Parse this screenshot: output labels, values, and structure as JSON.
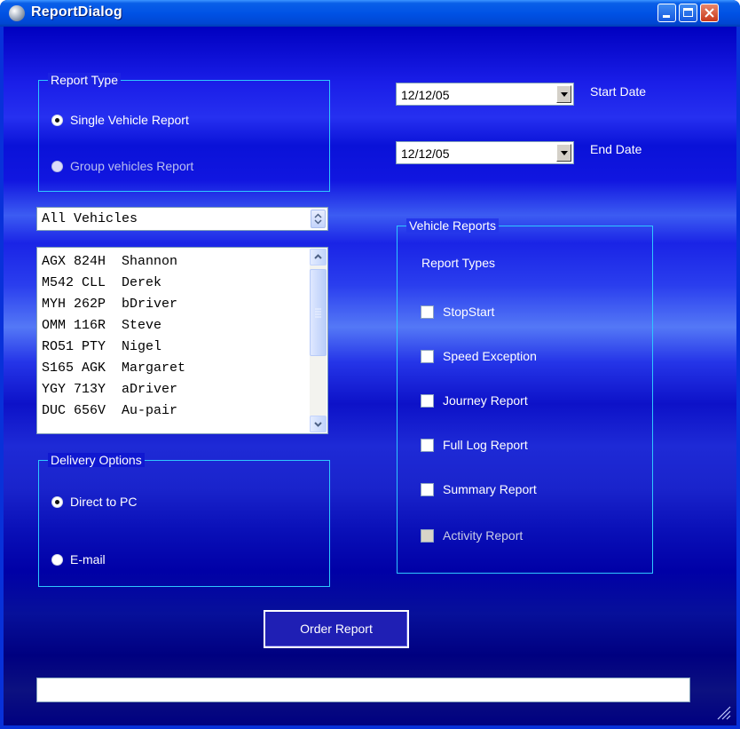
{
  "window": {
    "title": "ReportDialog",
    "icon": "globe-icon",
    "controls": [
      "minimize-icon",
      "maximize-icon",
      "close-icon"
    ]
  },
  "report_type": {
    "label": "Report Type",
    "options": [
      {
        "label": "Single Vehicle Report",
        "selected": true
      },
      {
        "label": "Group vehicles Report",
        "selected": false
      }
    ]
  },
  "dates": {
    "start": {
      "value": "12/12/05",
      "label": "Start Date"
    },
    "end": {
      "value": "12/12/05",
      "label": "End Date"
    }
  },
  "vehicle_filter": {
    "value": "All Vehicles"
  },
  "vehicle_list": [
    {
      "reg": "AGX 824H",
      "driver": "Shannon"
    },
    {
      "reg": "M542 CLL",
      "driver": "Derek"
    },
    {
      "reg": "MYH 262P",
      "driver": "bDriver"
    },
    {
      "reg": "OMM 116R",
      "driver": "Steve"
    },
    {
      "reg": "RO51 PTY",
      "driver": "Nigel"
    },
    {
      "reg": "S165 AGK",
      "driver": "Margaret"
    },
    {
      "reg": "YGY 713Y",
      "driver": "aDriver"
    },
    {
      "reg": "DUC 656V",
      "driver": "Au-pair"
    }
  ],
  "vehicle_reports": {
    "label": "Vehicle Reports",
    "subtitle": "Report Types",
    "items": [
      {
        "label": "StopStart",
        "checked": false,
        "enabled": true
      },
      {
        "label": "Speed Exception",
        "checked": false,
        "enabled": true
      },
      {
        "label": "Journey Report",
        "checked": false,
        "enabled": true
      },
      {
        "label": "Full Log Report",
        "checked": false,
        "enabled": true
      },
      {
        "label": "Summary Report",
        "checked": false,
        "enabled": true
      },
      {
        "label": "Activity Report",
        "checked": false,
        "enabled": false
      }
    ]
  },
  "delivery": {
    "label": "Delivery Options",
    "options": [
      {
        "label": "Direct to PC",
        "selected": true
      },
      {
        "label": "E-mail",
        "selected": false
      }
    ]
  },
  "order_button": {
    "label": "Order Report"
  },
  "status_bar": {
    "value": ""
  }
}
